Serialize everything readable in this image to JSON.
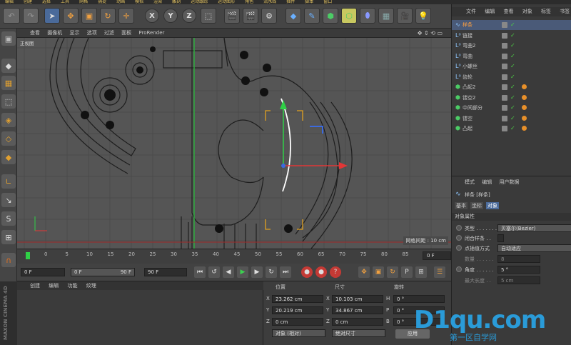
{
  "app": {
    "name": "MAXON CINEMA 4D"
  },
  "menubar": [
    "编辑",
    "创建",
    "选择",
    "工具",
    "网格",
    "捕捉",
    "动画",
    "模拟",
    "渲染",
    "雕刻",
    "运动跟踪",
    "运动图形",
    "角色",
    "流水线",
    "插件",
    "脚本",
    "窗口"
  ],
  "viewport": {
    "menu": [
      "查看",
      "摄像机",
      "显示",
      "选项",
      "过滤",
      "面板",
      "ProRender"
    ],
    "label": "正视图",
    "grid_spacing": "网格间距 : 10 cm"
  },
  "timeline": {
    "ticks": [
      "0",
      "5",
      "10",
      "15",
      "20",
      "25",
      "30",
      "35",
      "40",
      "45",
      "50",
      "55",
      "60",
      "65",
      "70",
      "75",
      "80",
      "85",
      "90"
    ],
    "end_field": "0 F"
  },
  "transport": {
    "start": "0 F",
    "current": "0 F",
    "preview_end": "90 F",
    "end": "90 F"
  },
  "material_manager": {
    "menu": [
      "创建",
      "编辑",
      "功能",
      "纹理"
    ]
  },
  "coordinates": {
    "headers": {
      "position": "位置",
      "size": "尺寸",
      "rotation": "旋转"
    },
    "rows": [
      {
        "axis": "X",
        "pos": "23.262 cm",
        "size_axis": "X",
        "size": "10.103 cm",
        "rot_axis": "H",
        "rot": "0 °"
      },
      {
        "axis": "Y",
        "pos": "20.219 cm",
        "size_axis": "Y",
        "size": "34.867 cm",
        "rot_axis": "P",
        "rot": "0 °"
      },
      {
        "axis": "Z",
        "pos": "0 cm",
        "size_axis": "Z",
        "size": "0 cm",
        "rot_axis": "B",
        "rot": "0 °"
      }
    ],
    "mode": "对象 (相对)",
    "size_mode": "绝对尺寸",
    "apply": "应用"
  },
  "objects": {
    "menu": [
      "文件",
      "编辑",
      "查看",
      "对象",
      "标签",
      "书签"
    ],
    "items": [
      {
        "name": "样条",
        "icon": "spline-icon",
        "selected": true,
        "tags": false
      },
      {
        "name": "链接",
        "icon": "null-icon",
        "selected": false,
        "tags": false
      },
      {
        "name": "弯曲2",
        "icon": "null-icon",
        "selected": false,
        "tags": false
      },
      {
        "name": "弯曲",
        "icon": "null-icon",
        "selected": false,
        "tags": false
      },
      {
        "name": "小螺丝",
        "icon": "null-icon",
        "selected": false,
        "tags": false
      },
      {
        "name": "齿轮",
        "icon": "null-icon",
        "selected": false,
        "tags": false
      },
      {
        "name": "凸起2",
        "icon": "extrude-icon",
        "selected": false,
        "tags": true
      },
      {
        "name": "镂空2",
        "icon": "extrude-icon",
        "selected": false,
        "tags": true
      },
      {
        "name": "中间部分",
        "icon": "extrude-icon",
        "selected": false,
        "tags": true
      },
      {
        "name": "镂空",
        "icon": "extrude-icon",
        "selected": false,
        "tags": true
      },
      {
        "name": "凸起",
        "icon": "extrude-icon",
        "selected": false,
        "tags": true
      }
    ]
  },
  "attributes": {
    "menu": [
      "模式",
      "编辑",
      "用户数据"
    ],
    "title": "样条 [样条]",
    "tabs": [
      "基本",
      "坐标",
      "对象"
    ],
    "section": "对象属性",
    "fields": [
      {
        "label": "类型 . . . . . . .",
        "value": "贝塞尔(Bezier)"
      },
      {
        "label": "闭合样条 . .",
        "value": ""
      },
      {
        "label": "点插值方式",
        "value": "自动适应"
      },
      {
        "label": "数量 . . . . . .",
        "value": "8"
      },
      {
        "label": "角度 . . . . . .",
        "value": "5 °"
      },
      {
        "label": "最大长度 . .",
        "value": "5 cm"
      }
    ]
  },
  "watermark": {
    "logo": "D1qu.com",
    "sub": "第一区自学网"
  }
}
